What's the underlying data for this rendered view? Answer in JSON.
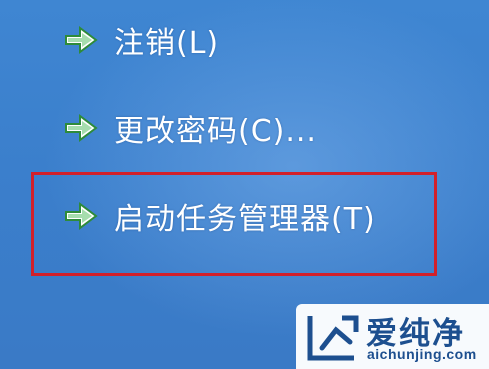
{
  "menu": {
    "items": [
      {
        "label": "注销(L)",
        "icon": "arrow-right-icon"
      },
      {
        "label": "更改密码(C)...",
        "icon": "arrow-right-icon"
      },
      {
        "label": "启动任务管理器(T)",
        "icon": "arrow-right-icon"
      }
    ],
    "highlighted_item": "启动任务管理器(T)"
  },
  "colors": {
    "background": "#3b7fcc",
    "highlight_border": "#d2202a",
    "arrow_fill": "#ffffff",
    "arrow_green": "#3aa845"
  },
  "watermark": {
    "brand": "爱纯净",
    "url": "aichunjing.com",
    "logo_icon": "aichunjing-logo-icon"
  }
}
